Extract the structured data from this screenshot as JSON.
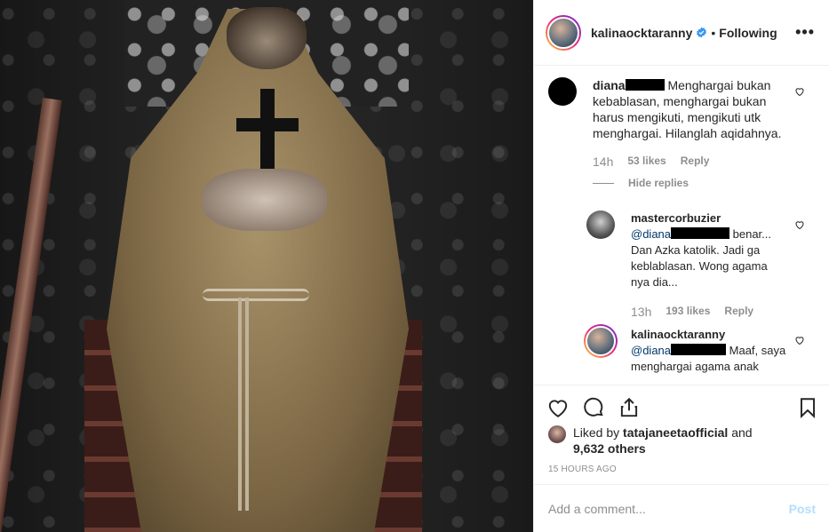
{
  "post": {
    "author": "kalinaocktaranny",
    "follow_state": "Following",
    "more_label": "•••"
  },
  "comments": [
    {
      "user": "diana",
      "text": "Menghargai bukan kebablasan, menghargai bukan harus mengikuti, mengikuti utk menghargai. Hilanglah aqidahnya.",
      "time": "14h",
      "likes": "53 likes",
      "reply_label": "Reply",
      "hide_replies": "Hide replies"
    },
    {
      "user": "mastercorbuzier",
      "mention": "@diana",
      "text": "benar... Dan Azka katolik. Jadi ga keblablasan. Wong agama nya dia...",
      "time": "13h",
      "likes": "193 likes",
      "reply_label": "Reply"
    },
    {
      "user": "kalinaocktaranny",
      "mention": "@diana",
      "text": "Maaf, saya menghargai agama anak"
    }
  ],
  "likes": {
    "prefix": "Liked by",
    "liker": "tatajaneetaofficial",
    "and": "and",
    "others": "9,632 others"
  },
  "timestamp": "15 HOURS AGO",
  "add_comment": {
    "placeholder": "Add a comment...",
    "post_label": "Post"
  },
  "colors": {
    "verified": "#3897f0",
    "mention": "#00376b",
    "muted": "#8e8e8e",
    "post_disabled": "#b2dffc"
  },
  "icons": [
    "verified-badge-icon",
    "more-options-icon",
    "heart-icon",
    "comment-icon",
    "share-icon",
    "bookmark-icon"
  ]
}
